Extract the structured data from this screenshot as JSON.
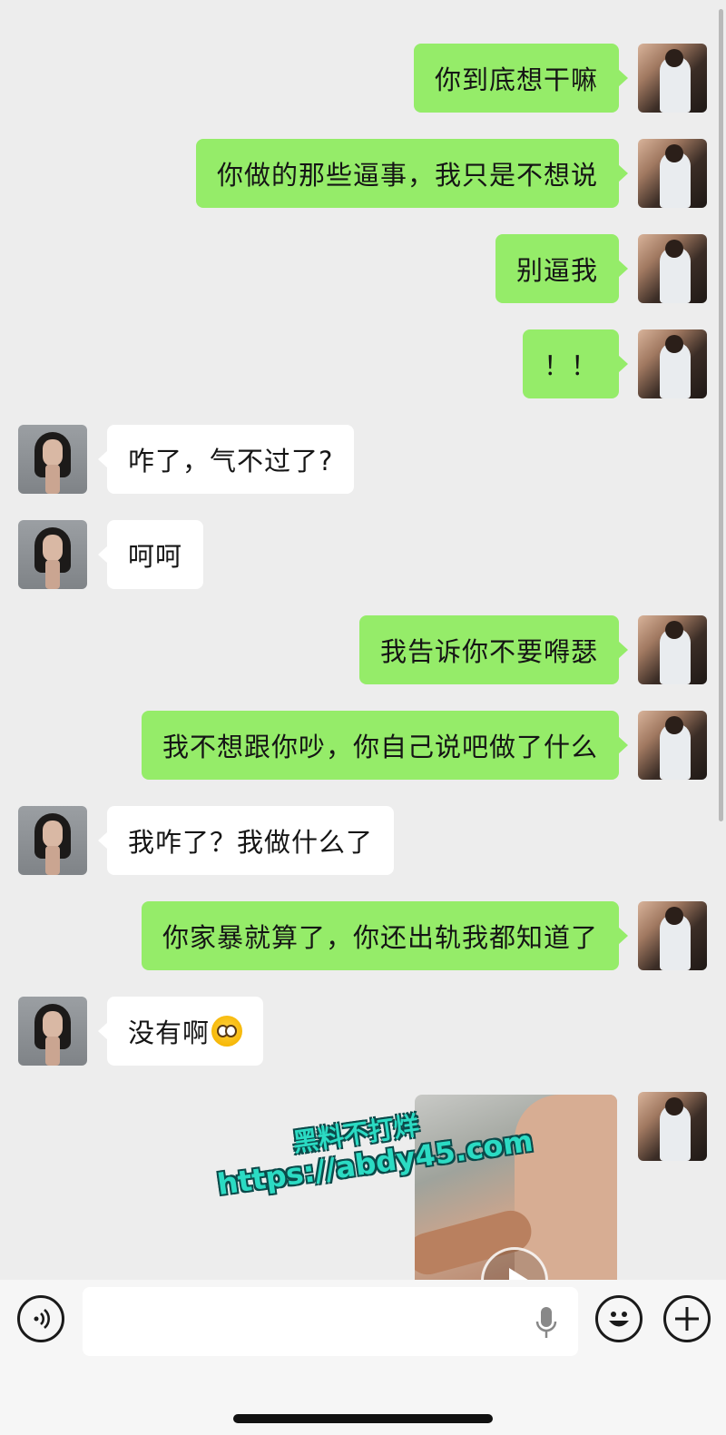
{
  "messages": [
    {
      "from": "me",
      "text": "你到底想干嘛"
    },
    {
      "from": "me",
      "text": "你做的那些逼事，我只是不想说"
    },
    {
      "from": "me",
      "text": "别逼我"
    },
    {
      "from": "me",
      "text": "！！"
    },
    {
      "from": "her",
      "text": "咋了，气不过了?"
    },
    {
      "from": "her",
      "text": "呵呵"
    },
    {
      "from": "me",
      "text": "我告诉你不要嘚瑟"
    },
    {
      "from": "me",
      "text": "我不想跟你吵，你自己说吧做了什么"
    },
    {
      "from": "her",
      "text": "我咋了？我做什么了"
    },
    {
      "from": "me",
      "text": "你家暴就算了，你还出轨我都知道了"
    },
    {
      "from": "her",
      "text": "没有啊",
      "emoji": "flushed-face-emoji"
    },
    {
      "from": "me",
      "type": "video"
    }
  ],
  "watermark": {
    "line1": "黑料不打烊",
    "line2": "https://abdy45.com"
  },
  "input_bar": {
    "placeholder": "",
    "icons": [
      "voice-icon",
      "microphone-icon",
      "emoji-icon",
      "plus-icon"
    ]
  },
  "colors": {
    "my_bubble": "#95ec69",
    "her_bubble": "#ffffff",
    "background": "#ededed"
  }
}
